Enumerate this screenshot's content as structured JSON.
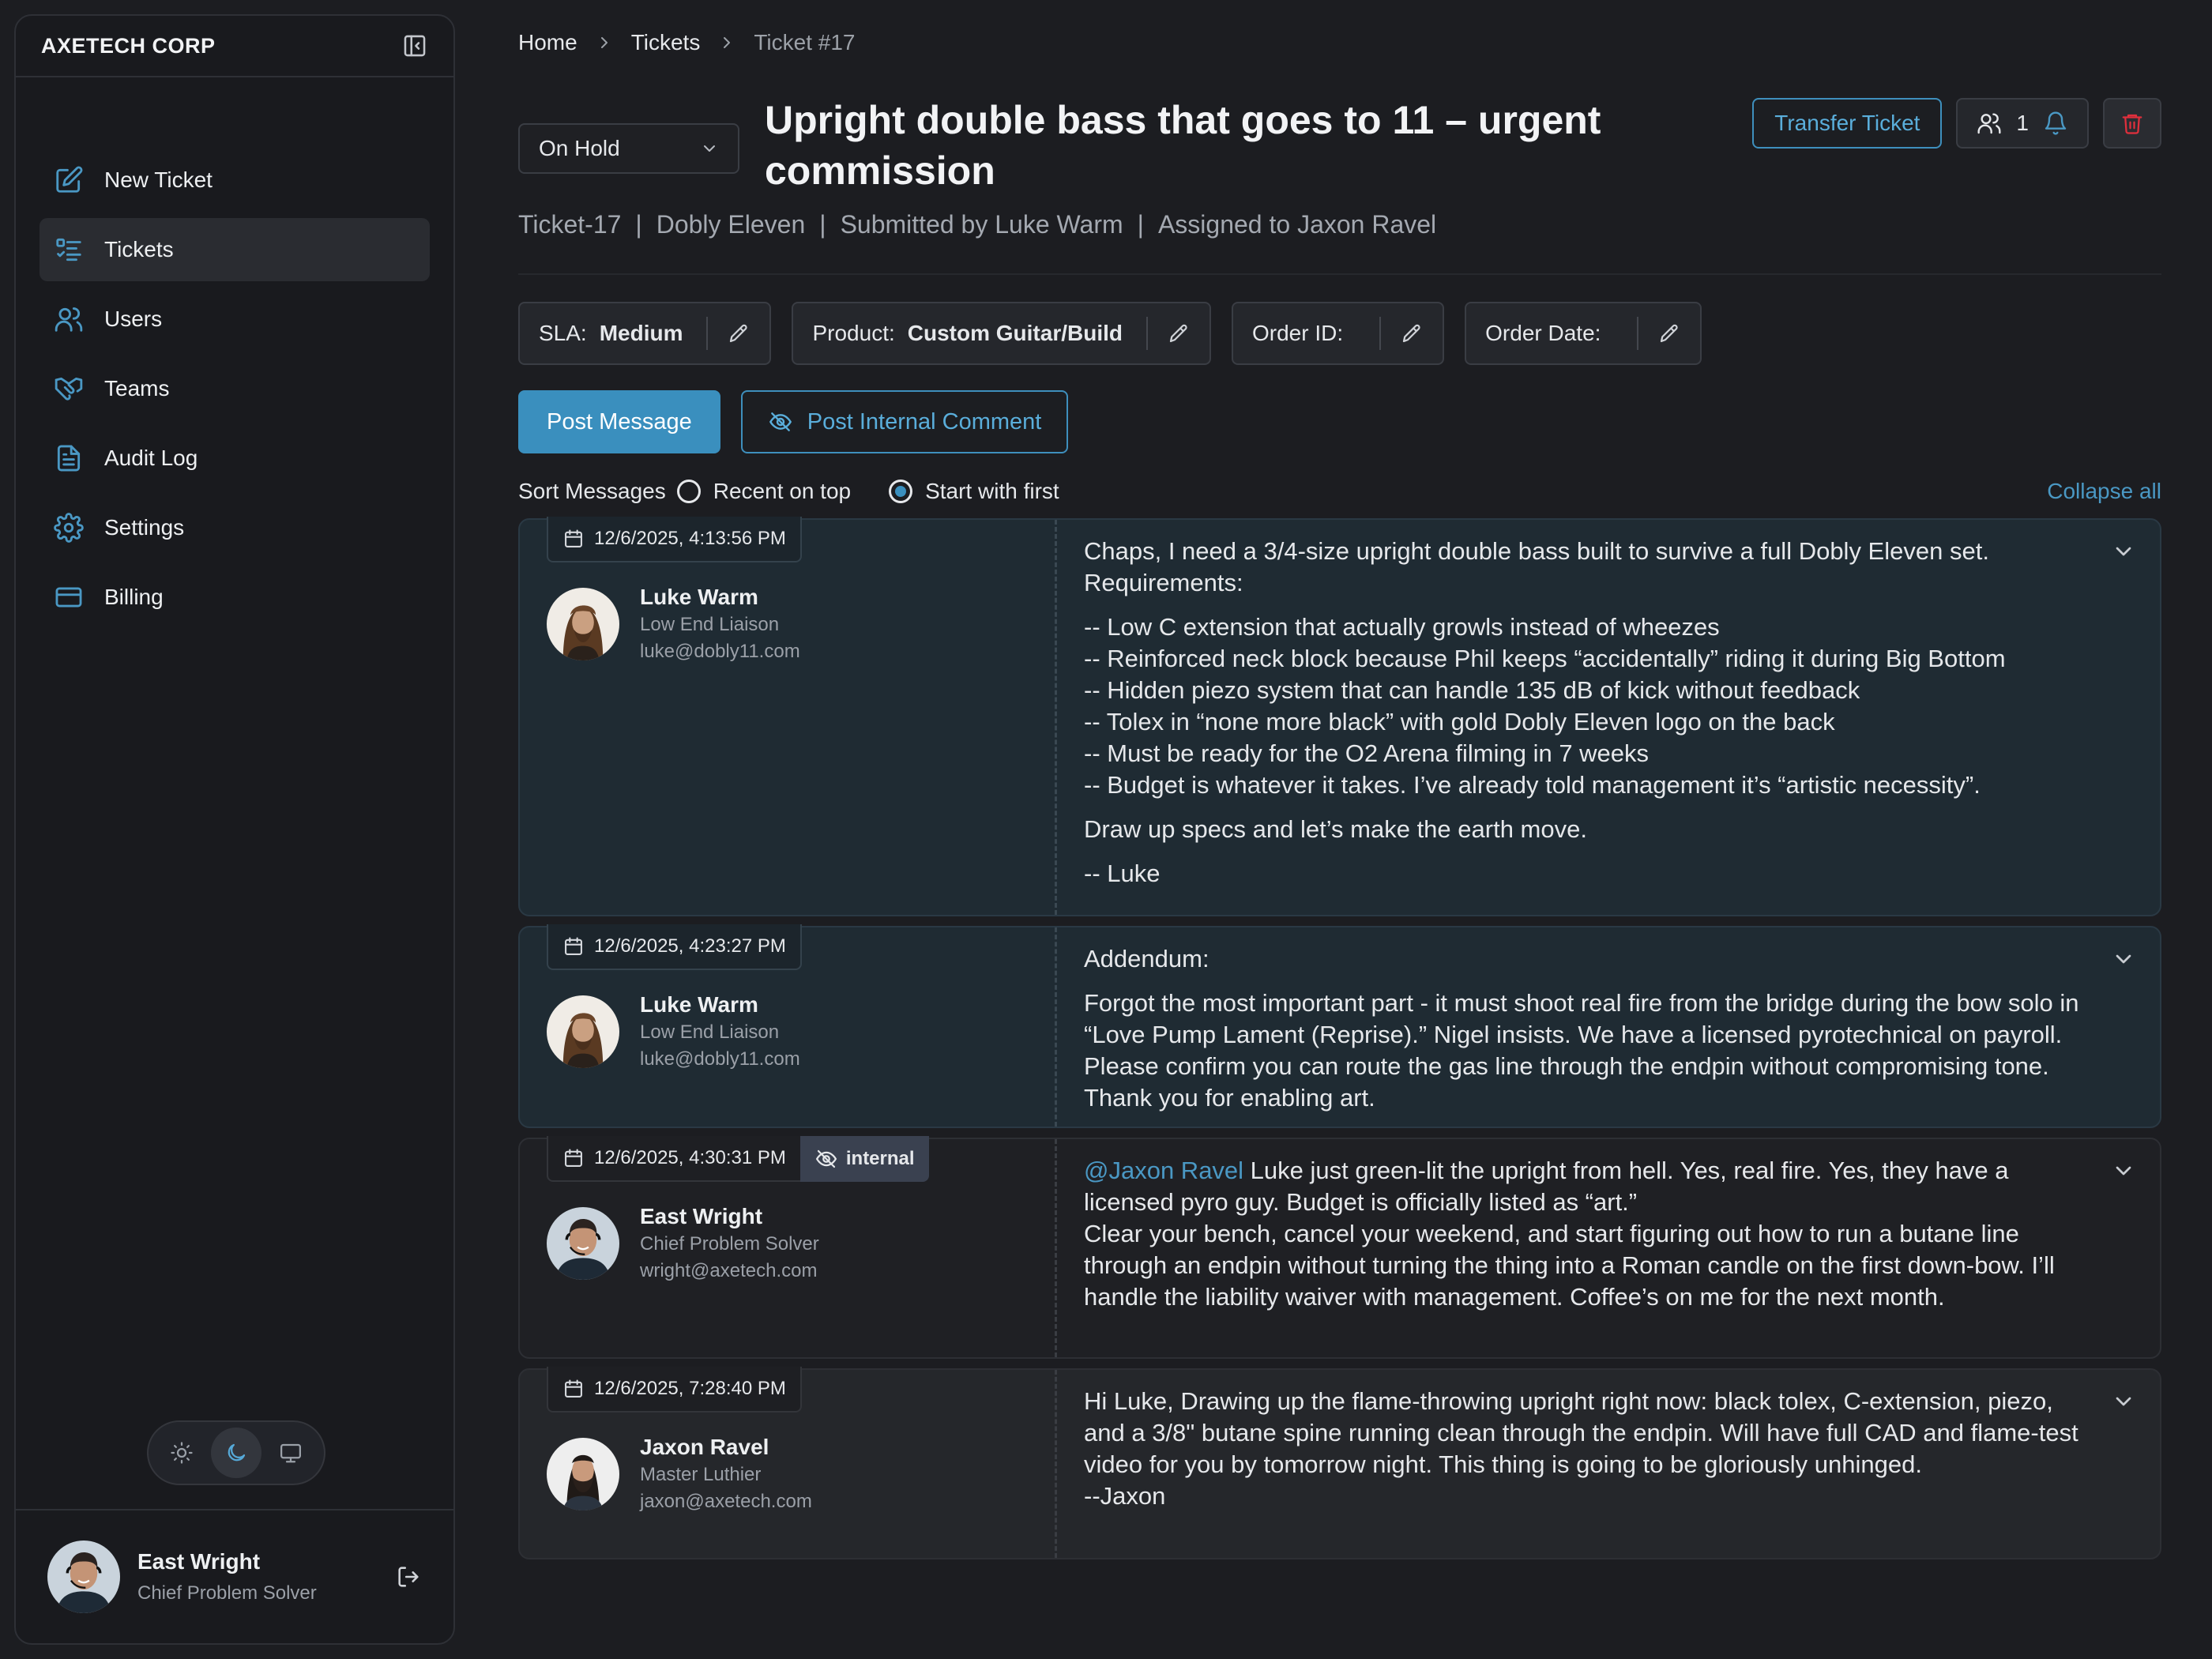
{
  "sidebar": {
    "brand": "AXETECH CORP",
    "items": [
      {
        "label": "New Ticket"
      },
      {
        "label": "Tickets"
      },
      {
        "label": "Users"
      },
      {
        "label": "Teams"
      },
      {
        "label": "Audit Log"
      },
      {
        "label": "Settings"
      },
      {
        "label": "Billing"
      }
    ],
    "active_item": "Tickets",
    "theme": "dark",
    "user": {
      "name": "East Wright",
      "role": "Chief Problem Solver"
    }
  },
  "breadcrumb": {
    "home": "Home",
    "tickets": "Tickets",
    "current": "Ticket #17"
  },
  "ticket": {
    "status": "On Hold",
    "title": "Upright double bass that goes to 11 – urgent commission",
    "id": "Ticket-17",
    "org": "Dobly Eleven",
    "submitted": "Submitted by Luke Warm",
    "assigned": "Assigned to Jaxon Ravel",
    "meta_separator": "|",
    "watchers": "1"
  },
  "actions": {
    "transfer": "Transfer Ticket",
    "post_message": "Post Message",
    "post_internal": "Post Internal Comment"
  },
  "fields": {
    "sla": {
      "label": "SLA:",
      "value": "Medium"
    },
    "product": {
      "label": "Product:",
      "value": "Custom Guitar/Build"
    },
    "order_id": {
      "label": "Order ID:",
      "value": ""
    },
    "order_date": {
      "label": "Order Date:",
      "value": ""
    }
  },
  "sort": {
    "label": "Sort Messages",
    "recent": "Recent on top",
    "first": "Start with first",
    "selected": "Start with first",
    "collapse_all": "Collapse all"
  },
  "messages": [
    {
      "timestamp": "12/6/2025, 4:13:56 PM",
      "author": {
        "name": "Luke Warm",
        "role": "Low End Liaison",
        "email": "luke@dobly11.com"
      },
      "p1": "Chaps, I need a 3/4-size upright double bass built to survive a full Dobly Eleven set. Requirements:",
      "list": [
        "-- Low C extension that actually growls instead of wheezes",
        "-- Reinforced neck block because Phil keeps “accidentally” riding it during Big Bottom",
        "-- Hidden piezo system that can handle 135 dB of kick without feedback",
        "-- Tolex in “none more black” with gold Dobly Eleven logo on the back",
        "-- Must be ready for the O2 Arena filming in 7 weeks",
        "-- Budget is whatever it takes. I’ve already told management it’s “artistic necessity”."
      ],
      "p2": "Draw up specs and let’s make the earth move.",
      "sign": "-- Luke"
    },
    {
      "timestamp": "12/6/2025, 4:23:27 PM",
      "author": {
        "name": "Luke Warm",
        "role": "Low End Liaison",
        "email": "luke@dobly11.com"
      },
      "p1": "Addendum:",
      "p2": "Forgot the most important part - it must shoot real fire from the bridge during the bow solo in “Love Pump Lament (Reprise).” Nigel insists. We have a licensed pyrotechnical on payroll. Please confirm you can route the gas line through the endpin without compromising tone. Thank you for enabling art."
    },
    {
      "timestamp": "12/6/2025, 4:30:31 PM",
      "internal": "internal",
      "author": {
        "name": "East Wright",
        "role": "Chief Problem Solver",
        "email": "wright@axetech.com"
      },
      "mention": "@Jaxon Ravel",
      "p1": " Luke just green-lit the upright from hell. Yes, real fire. Yes, they have a licensed pyro guy. Budget is officially listed as “art.”",
      "p2": "Clear your bench, cancel your weekend, and start figuring out how to run a butane line through an endpin without turning the thing into a Roman candle on the first down-bow. I’ll handle the liability waiver with management. Coffee’s on me for the next month."
    },
    {
      "timestamp": "12/6/2025, 7:28:40 PM",
      "author": {
        "name": "Jaxon Ravel",
        "role": "Master Luthier",
        "email": "jaxon@axetech.com"
      },
      "p1": "Hi Luke, Drawing up the flame-throwing upright right now: black tolex, C-extension, piezo, and a 3/8\" butane spine running clean through the endpin. Will have full CAD and flame-test video for you by tomorrow night. This thing is going to be gloriously unhinged.",
      "p2": "--Jaxon"
    }
  ],
  "colors": {
    "accent": "#3a8fbe",
    "danger": "#e02f3c",
    "customer_bg": "#1f2b33"
  }
}
